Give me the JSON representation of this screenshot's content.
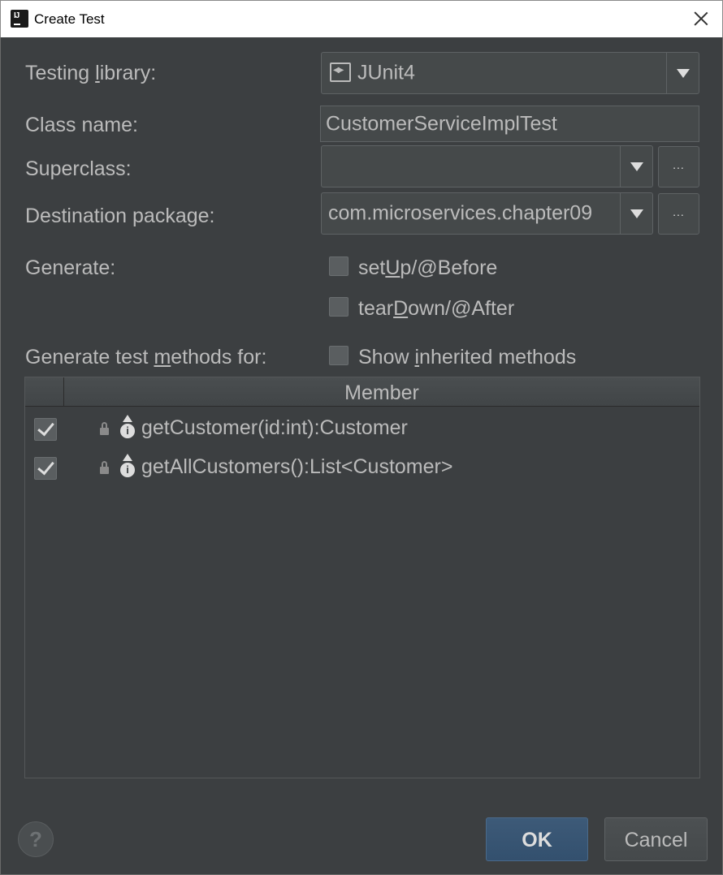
{
  "window": {
    "title": "Create Test",
    "app_icon_text": "IJ"
  },
  "form": {
    "testing_library": {
      "label_pre": "Testing ",
      "label_mnemonic": "l",
      "label_post": "ibrary:",
      "value": "JUnit4"
    },
    "class_name": {
      "label": "Class name:",
      "value": "CustomerServiceImplTest"
    },
    "superclass": {
      "label": "Superclass:",
      "value": ""
    },
    "destination_package": {
      "label": "Destination package:",
      "value": "com.microservices.chapter09"
    },
    "browse_label": "...",
    "generate": {
      "label": "Generate:",
      "setup": {
        "pre": "set",
        "mnemonic": "U",
        "post": "p/@Before",
        "checked": false
      },
      "teardown": {
        "pre": "tear",
        "mnemonic": "D",
        "post": "own/@After",
        "checked": false
      }
    },
    "methods_for": {
      "label_pre": "Generate test ",
      "label_mnemonic": "m",
      "label_post": "ethods for:",
      "show_inherited": {
        "pre": "Show ",
        "mnemonic": "i",
        "post": "nherited methods",
        "checked": false
      }
    }
  },
  "table": {
    "header_member": "Member",
    "rows": [
      {
        "method": "getCustomer(id:int):Customer",
        "checked": true,
        "icon": "method-icon"
      },
      {
        "method": "getAllCustomers():List<Customer>",
        "checked": true,
        "icon": "method-icon"
      }
    ]
  },
  "buttons": {
    "help": "?",
    "ok": "OK",
    "cancel": "Cancel"
  },
  "colors": {
    "background": "#3c3f41",
    "ok_button": "#365880",
    "text": "#bbbbbb"
  }
}
